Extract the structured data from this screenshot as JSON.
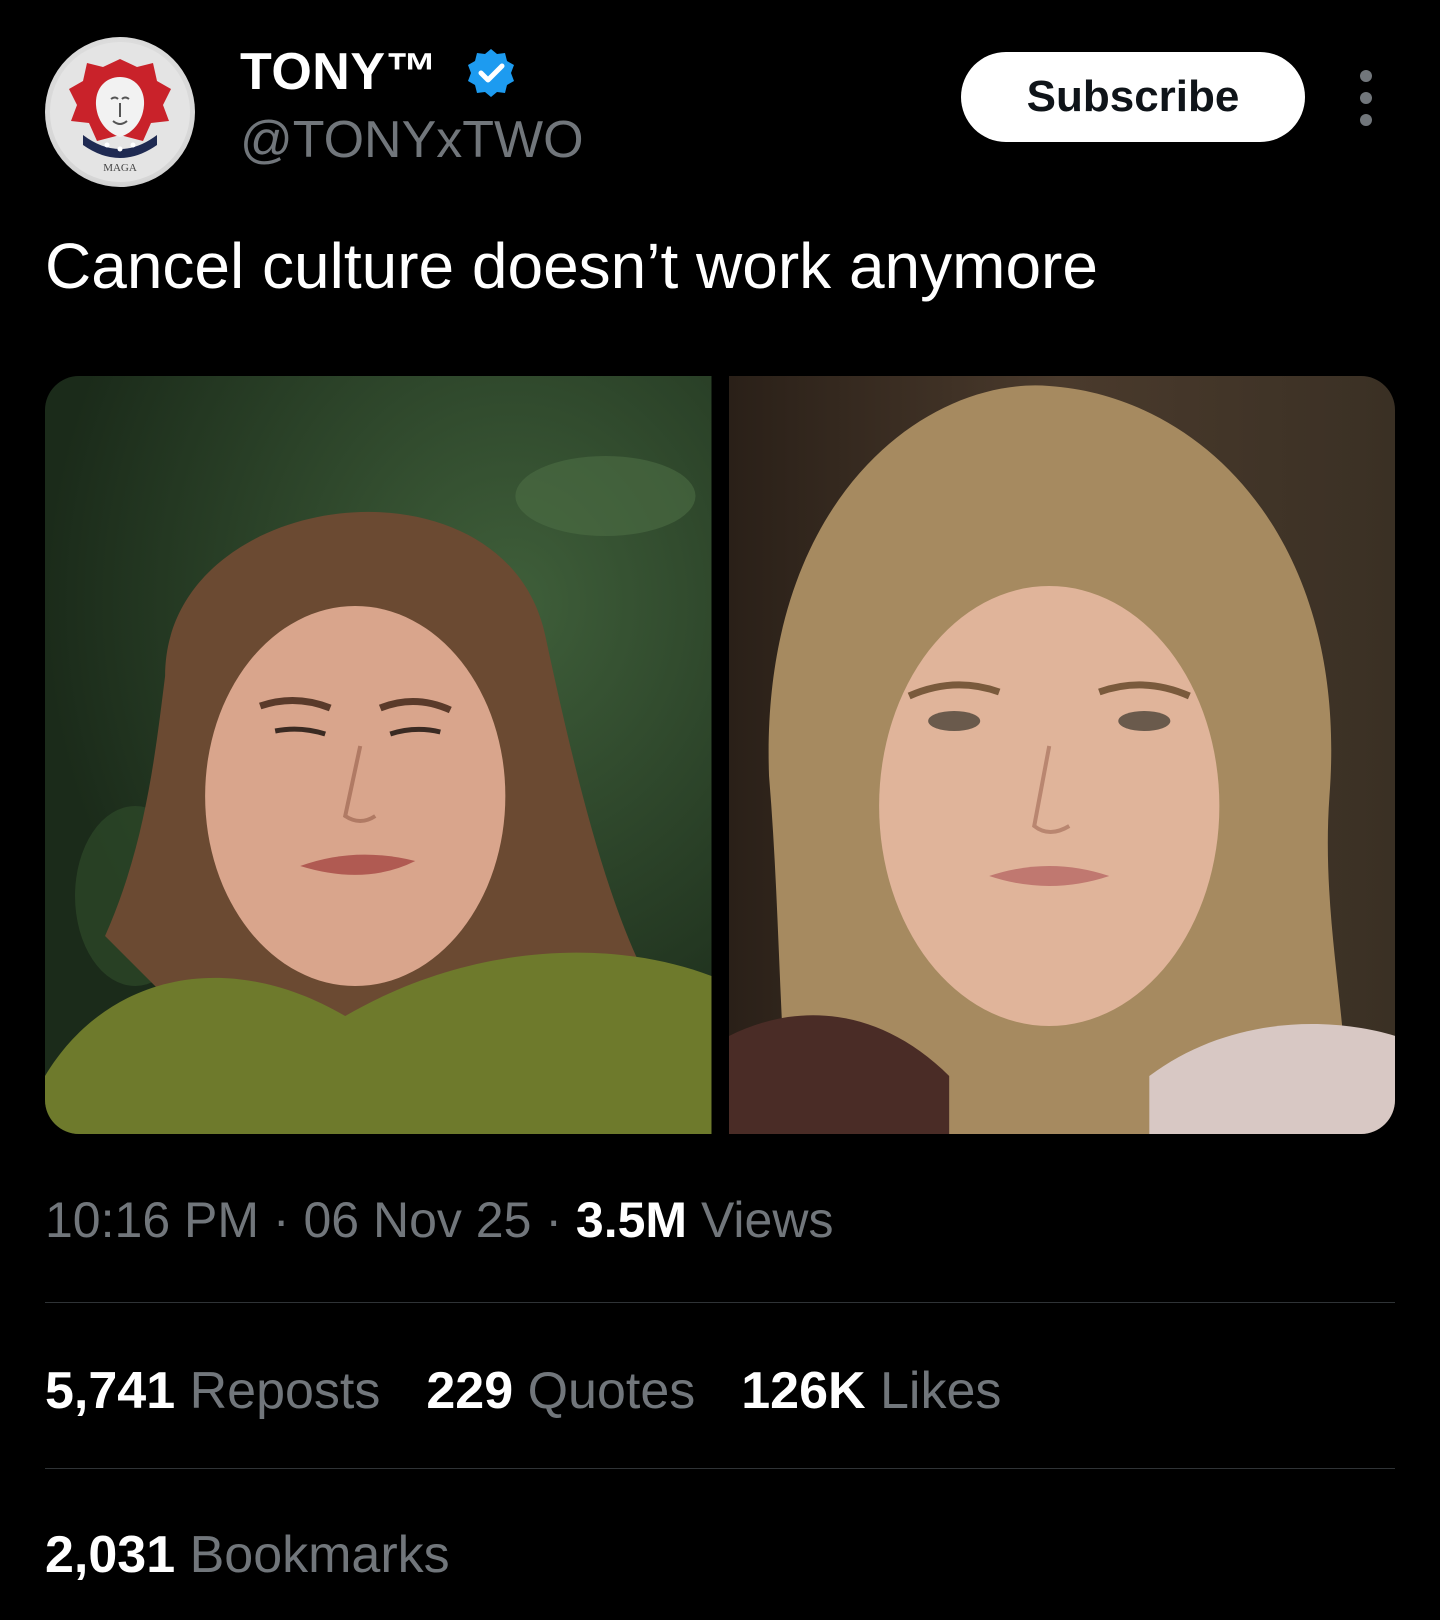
{
  "author": {
    "display_name": "TONY™",
    "handle": "@TONYxTWO",
    "avatar_icon": "lion-maga-logo-icon",
    "avatar_text": "MAGA",
    "verified": true,
    "verified_color": "#1d9bf0"
  },
  "actions": {
    "subscribe_label": "Subscribe",
    "more_icon": "more-vertical-icon"
  },
  "tweet": {
    "text": "Cancel culture doesn’t work anymore",
    "media": [
      {
        "alt": "photo-left"
      },
      {
        "alt": "photo-right"
      }
    ]
  },
  "meta": {
    "time": "10:16 PM",
    "date": "06 Nov 25",
    "views_count": "3.5M",
    "views_label": "Views",
    "separator": "·"
  },
  "stats": {
    "reposts_count": "5,741",
    "reposts_label": "Reposts",
    "quotes_count": "229",
    "quotes_label": "Quotes",
    "likes_count": "126K",
    "likes_label": "Likes",
    "bookmarks_count": "2,031",
    "bookmarks_label": "Bookmarks"
  },
  "colors": {
    "background": "#000000",
    "primary_text": "#ffffff",
    "secondary_text": "#71767b",
    "divider": "#2f3336"
  }
}
